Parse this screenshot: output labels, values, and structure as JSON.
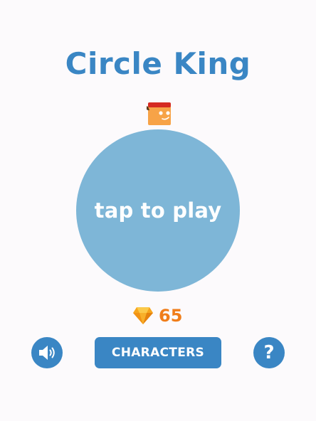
{
  "game": {
    "title": "Circle King",
    "play_label": "tap to play",
    "gem_count": "65"
  },
  "buttons": {
    "characters_label": "CHARACTERS",
    "sound_icon": "speaker-volume-icon",
    "help_glyph": "?"
  },
  "icons": {
    "gem": "diamond-gem-icon",
    "character": "block-character-red-cap"
  },
  "colors": {
    "background": "#fcfafc",
    "title": "#3a86c4",
    "circle": "#7eb6d7",
    "button": "#3a86c4",
    "gem_count": "#f07d1a",
    "gem": "#f7a51c",
    "character_body": "#f7a347",
    "character_cap": "#d52a22"
  }
}
